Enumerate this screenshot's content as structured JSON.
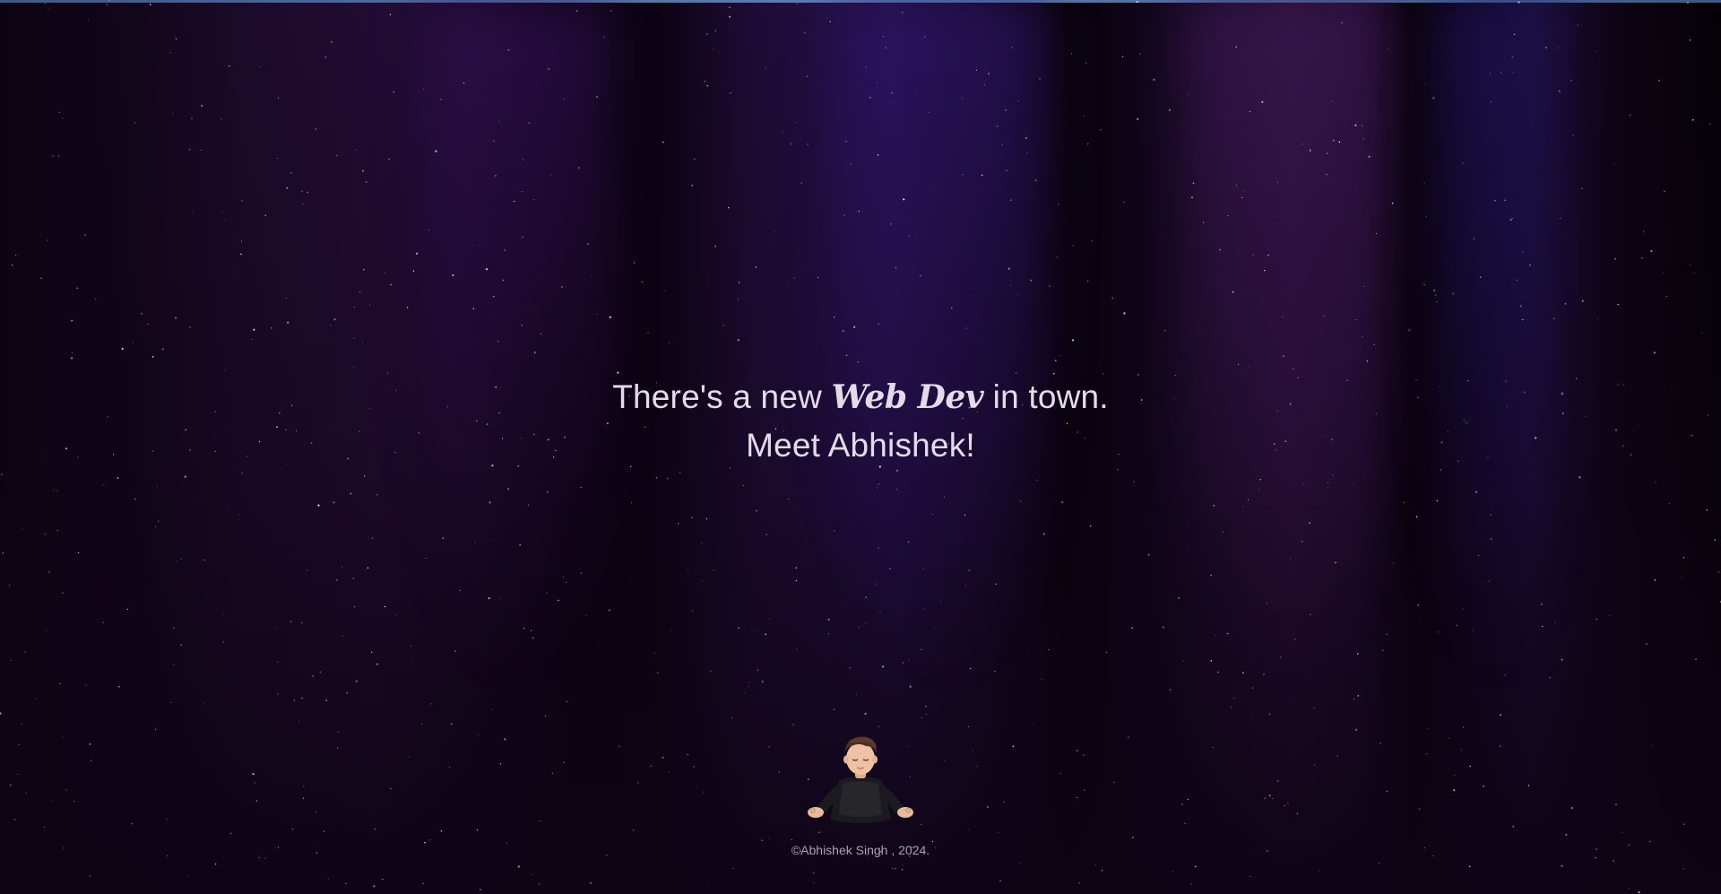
{
  "hero": {
    "line1_before": "There's a new",
    "line1_accent": "Web Dev",
    "line1_after": "in town.",
    "line2": "Meet Abhishek!"
  },
  "avatar": {
    "icon": "meditating-memoji-avatar-icon"
  },
  "footer": {
    "copyright": "©Abhishek Singh , 2024."
  },
  "colors": {
    "background": "#0e0414",
    "text": "#e2dcea",
    "footer_text": "#a9a2b4",
    "top_bar": "#5b7fb5"
  }
}
